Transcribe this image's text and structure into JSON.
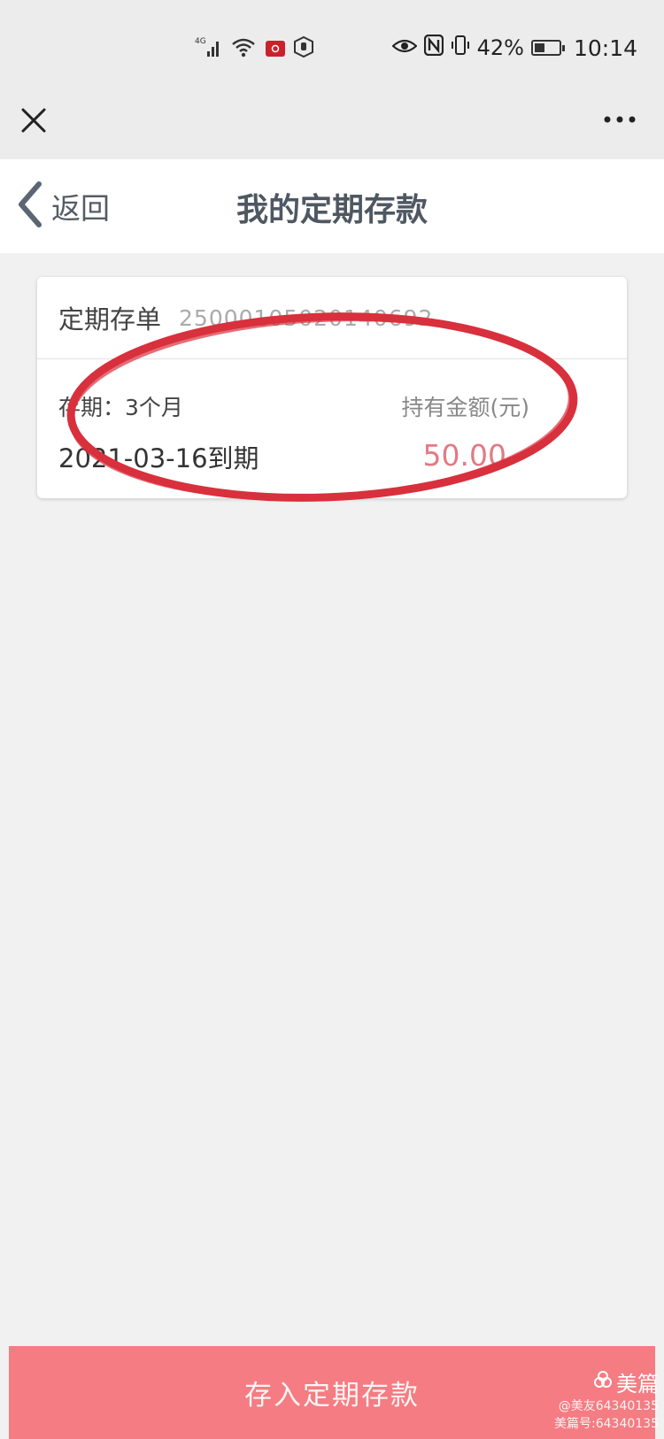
{
  "status_bar": {
    "network": "4G",
    "battery": "42%",
    "battery_level": 0.42,
    "time": "10:14"
  },
  "nav": {
    "back_label": "返回",
    "title": "我的定期存款"
  },
  "deposit": {
    "doc_label": "定期存单",
    "doc_number": "25000105020140692",
    "term": "存期：3个月",
    "maturity": "2021-03-16到期",
    "amount_label": "持有金额(元)",
    "amount": "50.00"
  },
  "footer": {
    "button_label": "存入定期存款"
  },
  "watermark": {
    "brand": "美篇",
    "line1": "@美友64340135",
    "line2": "美篇号:64340135"
  },
  "colors": {
    "accent": "#f47c82",
    "amount": "#e27a84",
    "annotation": "#d8303c"
  },
  "icons": [
    "close-icon",
    "more-icon",
    "chevron-left-icon",
    "eye-icon",
    "nfc-icon",
    "vibrate-icon",
    "battery-icon",
    "signal-icon",
    "wifi-icon"
  ]
}
